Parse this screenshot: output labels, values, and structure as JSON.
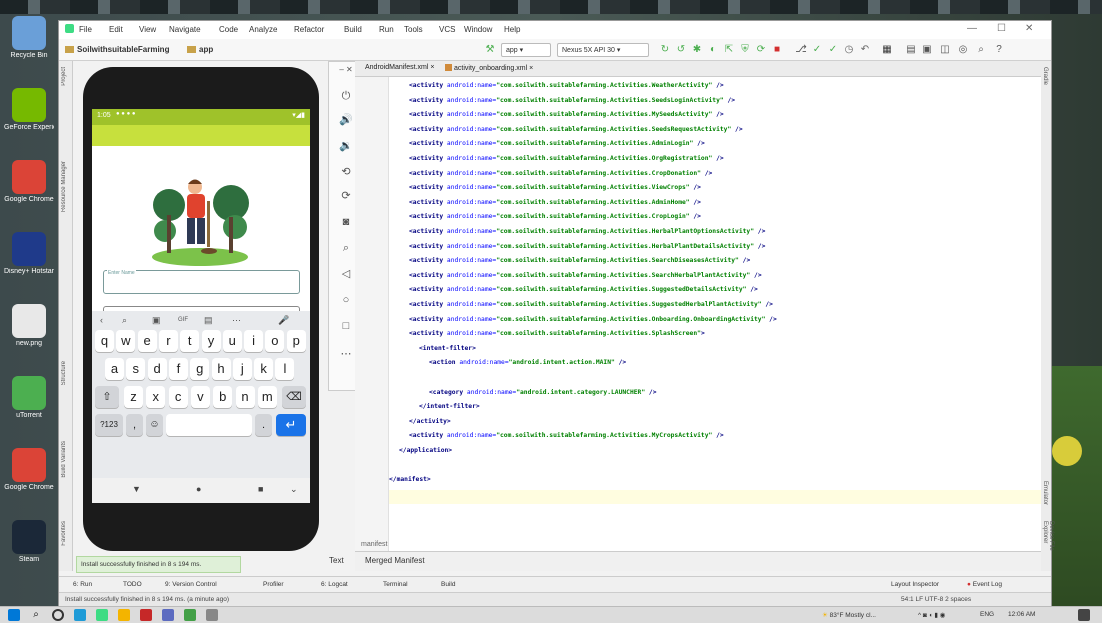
{
  "desktop": {
    "icons": [
      {
        "label": "Recycle Bin",
        "color": "#6a9fd8"
      },
      {
        "label": "GeForce Experience",
        "color": "#76b900"
      },
      {
        "label": "Google Chrome",
        "color": "#db4437"
      },
      {
        "label": "Disney+ Hotstar",
        "color": "#1f3a8a"
      },
      {
        "label": "new.png",
        "color": "#e8e8e8"
      },
      {
        "label": "uTorrent",
        "color": "#4caf50"
      },
      {
        "label": "Google Chrome",
        "color": "#db4437"
      },
      {
        "label": "Steam",
        "color": "#1b2838"
      }
    ]
  },
  "ide": {
    "menu": [
      "File",
      "Edit",
      "View",
      "Navigate",
      "Code",
      "Analyze",
      "Refactor",
      "Build",
      "Run",
      "Tools",
      "VCS",
      "Window",
      "Help"
    ],
    "breadcrumb_project": "SoilwithsuitableFarming",
    "breadcrumb_module": "app",
    "run_config": "app",
    "device": "Nexus 5X API 30",
    "tabs": [
      {
        "label": "AndroidManifest.xml"
      },
      {
        "label": "activity_onboarding.xml"
      }
    ],
    "left_tool_tabs": [
      "Project",
      "Resource Manager",
      "Structure",
      "Build Variants",
      "Favorites"
    ],
    "right_tool_tabs": [
      "Gradle",
      "Emulator",
      "Device File Explorer"
    ],
    "code_lines": [
      {
        "indent": 2,
        "kind": "activity",
        "cls": "WeatherActivity"
      },
      {
        "indent": 2,
        "kind": "activity",
        "cls": "SeedsLoginActivity"
      },
      {
        "indent": 2,
        "kind": "activity",
        "cls": "MySeedsActivity"
      },
      {
        "indent": 2,
        "kind": "activity",
        "cls": "SeedsRequestActivity"
      },
      {
        "indent": 2,
        "kind": "activity",
        "cls": "AdminLogin"
      },
      {
        "indent": 2,
        "kind": "activity",
        "cls": "OrgRegistration"
      },
      {
        "indent": 2,
        "kind": "activity",
        "cls": "CropDonation"
      },
      {
        "indent": 2,
        "kind": "activity",
        "cls": "ViewCrops"
      },
      {
        "indent": 2,
        "kind": "activity",
        "cls": "AdminHome"
      },
      {
        "indent": 2,
        "kind": "activity",
        "cls": "CropLogin"
      },
      {
        "indent": 2,
        "kind": "activity",
        "cls": "HerbalPlantOptionsActivity"
      },
      {
        "indent": 2,
        "kind": "activity",
        "cls": "HerbalPlantDetailsActivity"
      },
      {
        "indent": 2,
        "kind": "activity",
        "cls": "SearchDiseasesActivity"
      },
      {
        "indent": 2,
        "kind": "activity",
        "cls": "SearchHerbalPlantActivity"
      },
      {
        "indent": 2,
        "kind": "activity",
        "cls": "SuggestedDetailsActivity"
      },
      {
        "indent": 2,
        "kind": "activity",
        "cls": "SuggestedHerbalPlantActivity"
      },
      {
        "indent": 2,
        "kind": "activity",
        "cls": "Onboarding.OnboardingActivity"
      },
      {
        "indent": 2,
        "kind": "open",
        "cls": "SplashScreen"
      },
      {
        "indent": 3,
        "kind": "raw",
        "text": "<intent-filter>"
      },
      {
        "indent": 4,
        "kind": "attr",
        "tag": "action",
        "val": "android.intent.action.MAIN"
      },
      {
        "indent": 0,
        "kind": "blank"
      },
      {
        "indent": 4,
        "kind": "attr",
        "tag": "category",
        "val": "android.intent.category.LAUNCHER"
      },
      {
        "indent": 3,
        "kind": "raw",
        "text": "</intent-filter>"
      },
      {
        "indent": 2,
        "kind": "raw",
        "text": "</activity>"
      },
      {
        "indent": 2,
        "kind": "activity",
        "cls": "MyCropsActivity"
      },
      {
        "indent": 1,
        "kind": "raw",
        "text": "</application>"
      },
      {
        "indent": 0,
        "kind": "blank"
      },
      {
        "indent": 0,
        "kind": "raw",
        "text": "</manifest>"
      }
    ],
    "code_prefix": "com.soilwith.suitablefarming.Activities.",
    "editor_bottom_tabs": [
      "Text",
      "Merged Manifest"
    ],
    "editor_breadcrumb": "manifest",
    "toast": "Install successfully finished in 8 s 194 ms.",
    "tool_tabs": [
      "6: Run",
      "TODO",
      "9: Version Control",
      "Profiler",
      "6: Logcat",
      "Terminal",
      "Build"
    ],
    "tool_right": [
      "Layout Inspector",
      "Event Log"
    ],
    "status_left": "Install successfully finished in 8 s 194 ms. (a minute ago)",
    "status_right": "54:1  LF  UTF-8  2 spaces"
  },
  "phone": {
    "status_time": "1:05",
    "field_label": "Enter Name",
    "kb_row1": [
      "q",
      "w",
      "e",
      "r",
      "t",
      "y",
      "u",
      "i",
      "o",
      "p"
    ],
    "kb_row2": [
      "a",
      "s",
      "d",
      "f",
      "g",
      "h",
      "j",
      "k",
      "l"
    ],
    "kb_row3": [
      "z",
      "x",
      "c",
      "v",
      "b",
      "n",
      "m"
    ],
    "kb_sym": "?123",
    "kb_comma": ",",
    "kb_period": "."
  },
  "taskbar": {
    "weather": "83°F Mostly cl...",
    "lang": "ENG",
    "time": "12:06 AM"
  }
}
